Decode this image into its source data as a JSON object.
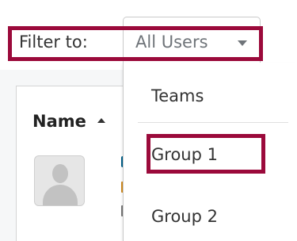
{
  "filter": {
    "label": "Filter to:",
    "selected_value": "All Users",
    "caret_icon": "caret-down-icon"
  },
  "list": {
    "column_header": "Name",
    "sort_icon": "sort-ascending-icon",
    "row_avatar_icon": "default-avatar-icon"
  },
  "dropdown": {
    "items": [
      {
        "label": "Teams"
      },
      {
        "label": "Group 1"
      },
      {
        "label": "Group 2"
      }
    ]
  },
  "colors": {
    "highlight": "#9b0a3b",
    "link": "#005f88",
    "muted_text": "#6f7479"
  }
}
